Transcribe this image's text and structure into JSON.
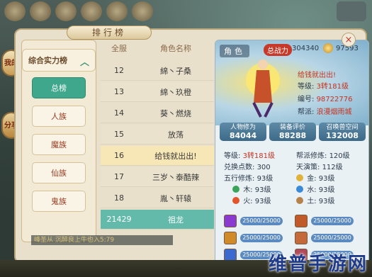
{
  "window": {
    "title": "排行榜",
    "close_label": "×"
  },
  "side": {
    "btn1": "我的",
    "btn2": "分享"
  },
  "categories": {
    "header": "综合实力榜",
    "items": [
      "总榜",
      "人族",
      "魔族",
      "仙族",
      "鬼族"
    ],
    "active_index": 0
  },
  "ranking": {
    "col_rank": "全服",
    "col_name": "角色名称",
    "rows": [
      {
        "rank": "12",
        "name": "綿丶子桑"
      },
      {
        "rank": "13",
        "name": "綿丶玖橙"
      },
      {
        "rank": "14",
        "name": "葵丶燃烧"
      },
      {
        "rank": "15",
        "name": "放荡"
      },
      {
        "rank": "16",
        "name": "给钱就出出!"
      },
      {
        "rank": "17",
        "name": "三岁丶泰酷辣"
      },
      {
        "rank": "18",
        "name": "胤丶轩辕"
      }
    ],
    "self_row": {
      "rank": "21429",
      "name": "祖龙"
    }
  },
  "detail": {
    "tab_label": "角色",
    "power_badge": "总战力",
    "power_value": "304340",
    "coin_value": "97593",
    "char_name": "给钱就出出!",
    "level_label": "等级:",
    "level_value": "3转181级",
    "id_label": "编号:",
    "id_value": "98722776",
    "guild_label": "帮派:",
    "guild_value": "浪漫烟雨城",
    "scores": [
      {
        "label": "人物修为",
        "value": "84044"
      },
      {
        "label": "装备评价",
        "value": "88288"
      },
      {
        "label": "召唤兽空间",
        "value": "132008"
      }
    ],
    "stats": {
      "level_label": "等级:",
      "level_value": "3转181级",
      "guild_cult_label": "帮派修炼:",
      "guild_cult_value": "120级",
      "exchange_label": "兑换点数:",
      "exchange_value": "300",
      "tianyan_label": "天演策:",
      "tianyan_value": "112级",
      "five_label": "五行修炼:",
      "five_value": "93级",
      "ghost_label": "鬼魂:",
      "ghost_value": "93级",
      "wood_label": "木:",
      "wood_value": "93级",
      "gold_label": "金:",
      "gold_value": "93级",
      "fire_label": "火:",
      "fire_value": "93级",
      "water_label": "水:",
      "water_value": "93级",
      "earth_label": "土:",
      "earth_value": "93级"
    },
    "bars": [
      "25000/25000",
      "25000/25000",
      "25000/25000",
      "25000/25000",
      "25000/25000",
      "25000/25000"
    ],
    "colors": {
      "wood": "#3aa35a",
      "gold": "#e0b23a",
      "fire": "#e2552a",
      "water": "#3a8ad6",
      "earth": "#b5834a",
      "accent": "#3fa88c",
      "red": "#c43322"
    }
  },
  "chat_line": "峰圣从 沉醉良上牛也入5:79",
  "watermark": "维普手游网"
}
